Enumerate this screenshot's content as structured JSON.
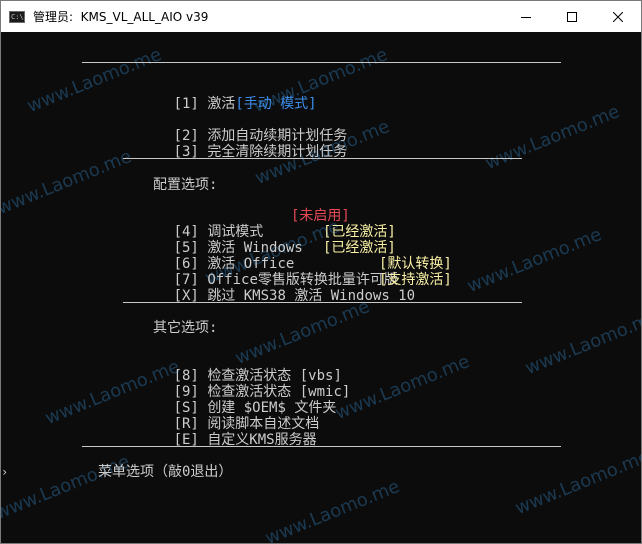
{
  "window": {
    "title": "管理员:  KMS_VL_ALL_AIO v39",
    "icon_text": "C:\\"
  },
  "menu": {
    "activate": {
      "key": "[1]",
      "label": "激活",
      "mode": "[手动 模式]"
    },
    "add_task": {
      "key": "[2]",
      "label": "添加自动续期计划任务"
    },
    "remove_task": {
      "key": "[3]",
      "label": "完全清除续期计划任务"
    },
    "config_header": "配置选项:",
    "debug": {
      "key": "[4]",
      "label": "调试模式",
      "status": "[未启用]"
    },
    "windows": {
      "key": "[5]",
      "label": "激活 Windows",
      "status": "[已经激活]"
    },
    "office": {
      "key": "[6]",
      "label": "激活 Office",
      "status": "[已经激活]"
    },
    "office_convert": {
      "key": "[7]",
      "label": "Office零售版转换批量许可版",
      "status": "[默认转换]"
    },
    "skip_kms38": {
      "key": "[X]",
      "label": "跳过 KMS38 激活 Windows 10",
      "status": "[支持激活]"
    },
    "other_header": "其它选项:",
    "check_vbs": {
      "key": "[8]",
      "label": "检查激活状态 [vbs]"
    },
    "check_wmic": {
      "key": "[9]",
      "label": "检查激活状态 [wmic]"
    },
    "create_oem": {
      "key": "[S]",
      "label": "创建 $OEM$ 文件夹"
    },
    "readme": {
      "key": "[R]",
      "label": "阅读脚本自述文档"
    },
    "custom_kms": {
      "key": "[E]",
      "label": "自定义KMS服务器"
    },
    "prompt": "菜单选项（敲0退出）"
  },
  "watermark": {
    "text": "www.Laomo.me"
  },
  "colors": {
    "background": "#0c0c0c",
    "text": "#cccccc",
    "highlight_blue": "#3b8eea",
    "status_red": "#e74856",
    "status_yellow": "#f9f1a5"
  }
}
